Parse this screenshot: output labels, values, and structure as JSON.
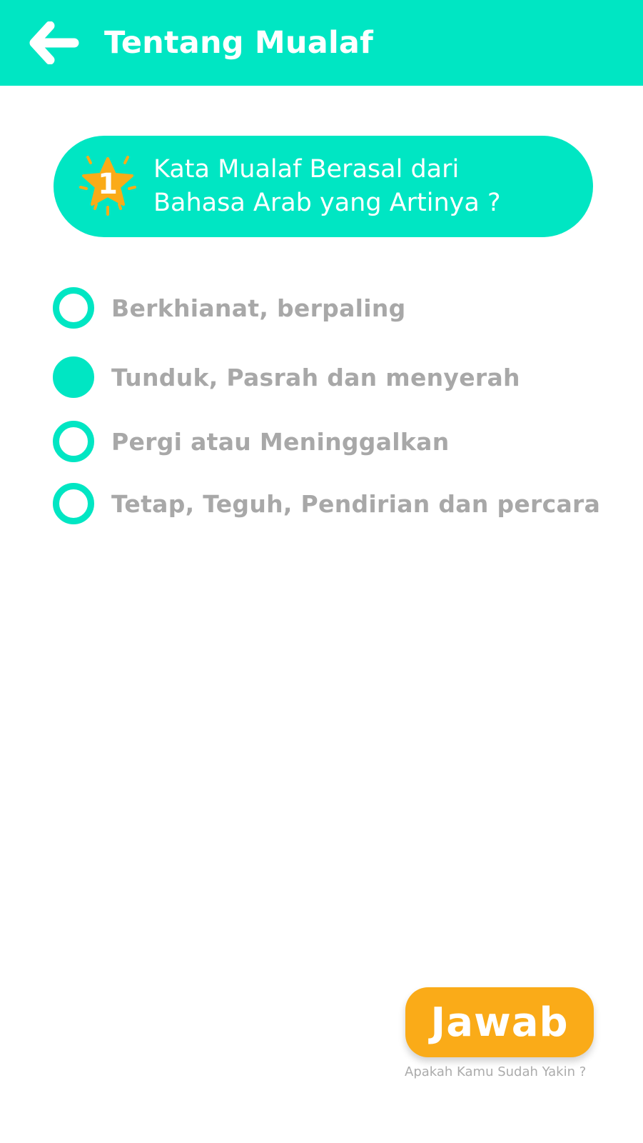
{
  "header": {
    "title": "Tentang Mualaf",
    "back_icon": "arrow-left-icon"
  },
  "question": {
    "number": "1",
    "badge_icon": "star-icon",
    "text_line1": "Kata Mualaf Berasal dari",
    "text_line2": "Bahasa Arab yang Artinya ?"
  },
  "options": [
    {
      "label": "Berkhianat, berpaling",
      "selected": false
    },
    {
      "label": "Tunduk, Pasrah dan menyerah",
      "selected": true
    },
    {
      "label": "Pergi atau Meninggalkan",
      "selected": false
    },
    {
      "label": "Tetap, Teguh, Pendirian dan percara",
      "selected": false
    }
  ],
  "answer": {
    "label": "Jawab",
    "hint": "Apakah Kamu Sudah Yakin ?"
  },
  "colors": {
    "primary": "#00E6C3",
    "accent": "#FAAB18",
    "option_text": "#A8A8A8"
  }
}
